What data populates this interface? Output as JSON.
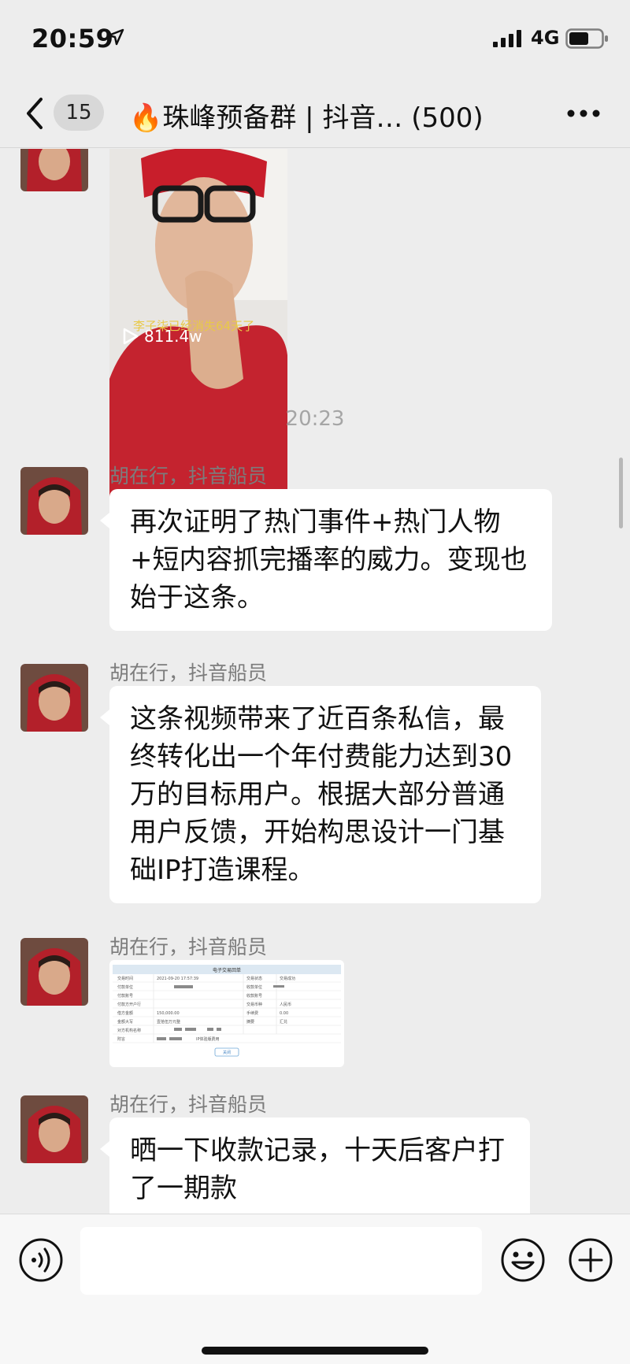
{
  "status_bar": {
    "time": "20:59",
    "network": "4G"
  },
  "nav": {
    "unread_count": "15",
    "title": "🔥珠峰预备群 | 抖音…  (500)"
  },
  "video": {
    "caption": "李子柒已经消失64天了",
    "play_count": "811.4w"
  },
  "timestamp": "20:23",
  "messages": [
    {
      "sender": "胡在行，抖音船员",
      "text": "再次证明了热门事件+热门人物+短内容抓完播率的威力。变现也始于这条。"
    },
    {
      "sender": "胡在行，抖音船员",
      "text": "这条视频带来了近百条私信，最终转化出一个年付费能力达到30万的目标用户。根据大部分普通用户反馈，开始构思设计一门基础IP打造课程。"
    },
    {
      "sender": "胡在行，抖音船员",
      "text": ""
    },
    {
      "sender": "胡在行，抖音船员",
      "text": "晒一下收款记录，十天后客户打了一期款"
    }
  ],
  "receipt": {
    "header": "电子交易回单",
    "rows": [
      [
        "交易时间",
        "2021-09-20 17:57:39",
        "交易状态",
        "交易成功"
      ],
      [
        "付款单位",
        "",
        "收款单位",
        ""
      ],
      [
        "付款账号",
        "",
        "收款账号",
        ""
      ],
      [
        "付款方开户行",
        "",
        "交易币种",
        "人民币"
      ],
      [
        "借方金额",
        "150,000.00",
        "手续费",
        "0.00"
      ],
      [
        "金额大写",
        "壹拾伍万元整",
        "摘要",
        "汇兑"
      ],
      [
        "对方机构名称",
        "",
        "",
        ""
      ],
      [
        "附言",
        "IP体验版费用",
        "",
        ""
      ]
    ],
    "button": "关闭"
  },
  "colors": {
    "background": "#ededed",
    "bubble": "#ffffff",
    "sender": "#7c7c7c",
    "timestamp": "#a5a5a5",
    "hoodie_red": "#b3202a"
  }
}
